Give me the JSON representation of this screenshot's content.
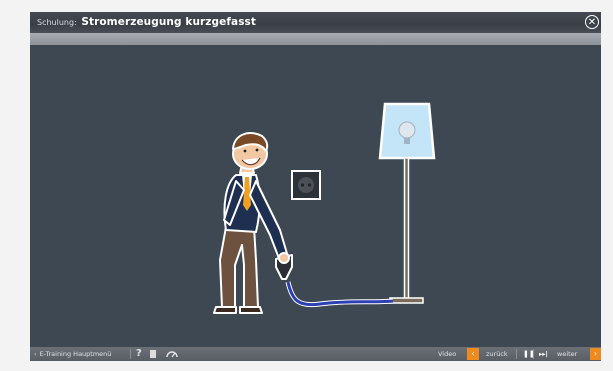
{
  "window": {
    "title_prefix": "Schulung:",
    "title": "Stromerzeugung kurzgefasst",
    "close_icon": "close-icon"
  },
  "toolbar": {
    "menu_label": "E-Training Hauptmenü",
    "help_label": "?",
    "video_label": "Video",
    "back_label": "zurück",
    "next_label": "weiter",
    "icons": [
      "arrow-left-icon",
      "help-icon",
      "document-icon",
      "speed-icon",
      "pause-icon",
      "skip-icon",
      "arrow-right-icon"
    ]
  },
  "colors": {
    "stage_bg": "#3d4853",
    "accent": "#f08a1c",
    "cable": "#2c3fb5",
    "lampshade": "#c4e4f7"
  }
}
